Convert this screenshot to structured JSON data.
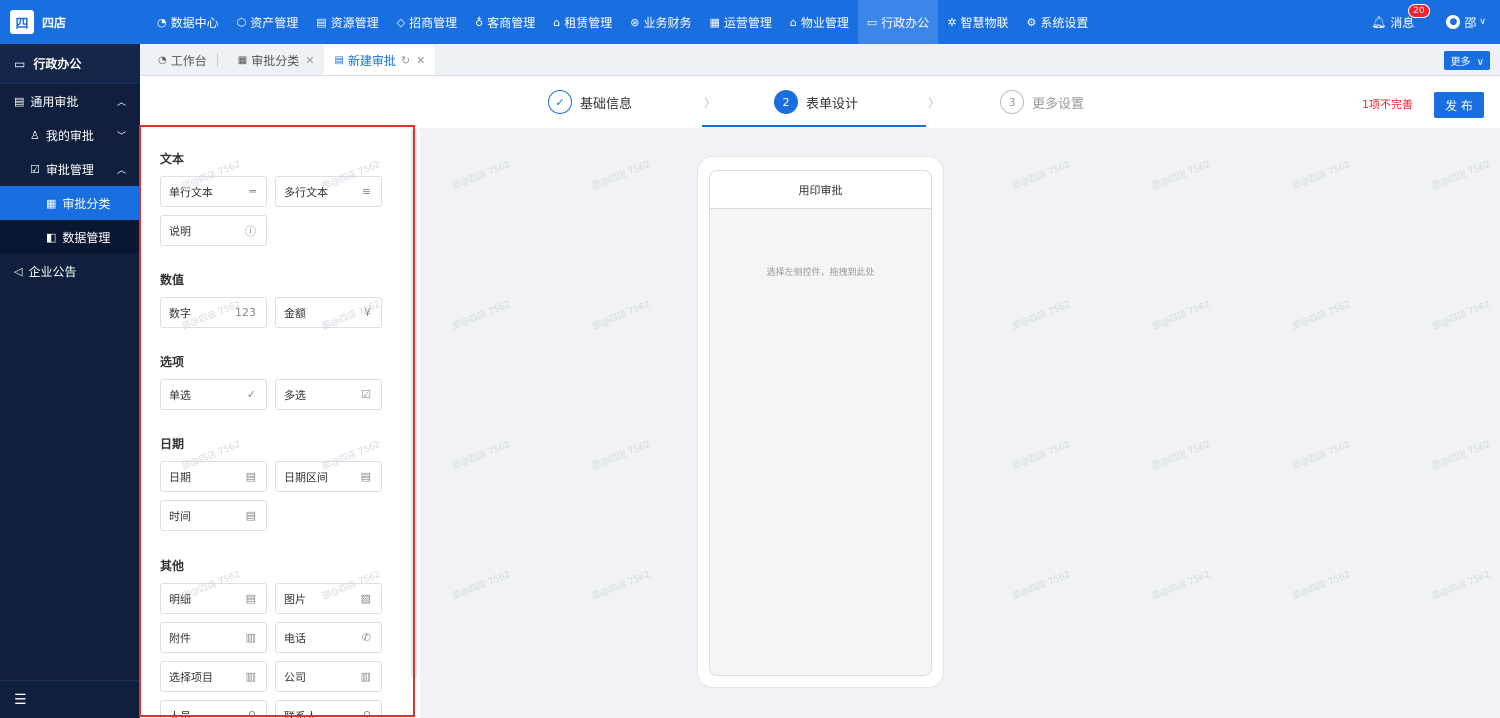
{
  "logo": {
    "mark": "四",
    "text": "四店"
  },
  "topnav": [
    {
      "icon": "◔",
      "label": "数据中心"
    },
    {
      "icon": "⬡",
      "label": "资产管理"
    },
    {
      "icon": "▤",
      "label": "资源管理"
    },
    {
      "icon": "◇",
      "label": "招商管理"
    },
    {
      "icon": "♁",
      "label": "客商管理"
    },
    {
      "icon": "⌂",
      "label": "租赁管理"
    },
    {
      "icon": "⊛",
      "label": "业务财务"
    },
    {
      "icon": "▦",
      "label": "运营管理"
    },
    {
      "icon": "⌂",
      "label": "物业管理"
    },
    {
      "icon": "▭",
      "label": "行政办公"
    },
    {
      "icon": "✲",
      "label": "智慧物联"
    },
    {
      "icon": "⚙",
      "label": "系统设置"
    }
  ],
  "header_right": {
    "messages_label": "消息",
    "messages_count": "20",
    "user": "邵"
  },
  "sidebar": {
    "title": "行政办公",
    "items": [
      {
        "label": "通用审批"
      },
      {
        "label": "我的审批"
      },
      {
        "label": "审批管理"
      },
      {
        "label": "审批分类"
      },
      {
        "label": "数据管理"
      },
      {
        "label": "企业公告"
      }
    ]
  },
  "tabs": [
    {
      "label": "工作台"
    },
    {
      "label": "审批分类"
    },
    {
      "label": "新建审批"
    }
  ],
  "more_label": "更多",
  "steps": [
    {
      "number": "✓",
      "label": "基础信息"
    },
    {
      "number": "2",
      "label": "表单设计"
    },
    {
      "number": "3",
      "label": "更多设置"
    }
  ],
  "warning": "1项不完善",
  "publish_label": "发 布",
  "groups": [
    {
      "title": "文本",
      "controls": [
        {
          "label": "单行文本",
          "icon": "═"
        },
        {
          "label": "多行文本",
          "icon": "≡"
        },
        {
          "label": "说明",
          "icon": "ⓘ"
        }
      ]
    },
    {
      "title": "数值",
      "controls": [
        {
          "label": "数字",
          "icon": "123"
        },
        {
          "label": "金额",
          "icon": "¥"
        }
      ]
    },
    {
      "title": "选项",
      "controls": [
        {
          "label": "单选",
          "icon": "✓"
        },
        {
          "label": "多选",
          "icon": "☑"
        }
      ]
    },
    {
      "title": "日期",
      "controls": [
        {
          "label": "日期",
          "icon": "▤"
        },
        {
          "label": "日期区间",
          "icon": "▤"
        },
        {
          "label": "时间",
          "icon": "▤"
        }
      ]
    },
    {
      "title": "其他",
      "controls": [
        {
          "label": "明细",
          "icon": "▤"
        },
        {
          "label": "图片",
          "icon": "▨"
        },
        {
          "label": "附件",
          "icon": "▥"
        },
        {
          "label": "电话",
          "icon": "✆"
        },
        {
          "label": "选择项目",
          "icon": "▥"
        },
        {
          "label": "公司",
          "icon": "▥"
        },
        {
          "label": "人员",
          "icon": "⚲"
        },
        {
          "label": "联系人",
          "icon": "⚲"
        }
      ]
    }
  ],
  "phone": {
    "title": "用印审批",
    "hint": "选择左侧控件，拖拽到此处"
  },
  "watermark": "邵@四店 7562"
}
